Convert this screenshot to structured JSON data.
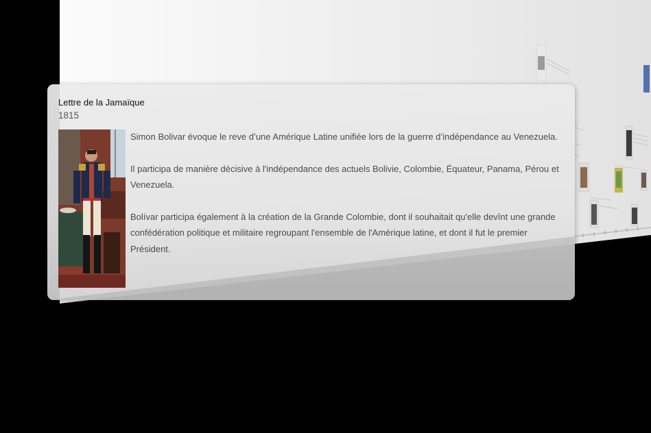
{
  "event": {
    "title": "Lettre de la Jamaïque",
    "year": "1815",
    "paragraphs": [
      "Simon Bolivar évoque le reve d’une Amérique Latine unifiée lors de la guerre d’indépendance au Venezuela.",
      "Il participa de manière décisive à l'indépendance des actuels Bolivie, Colombie, Équateur, Panama, Pérou et Venezuela.",
      "Bolívar participa également à la création de la Grande Colombie, dont il souhaitait qu'elle devînt une grande confédération politique et militaire regroupant l'ensemble de l'Amérique latine, et dont il fut le premier Président."
    ],
    "image": "simon-bolivar-portrait"
  },
  "colors": {
    "background": "#000000",
    "plane": "#f2f2f2",
    "card": "#e6e6e6",
    "title": "#111111",
    "body_text": "#4a4a4a"
  }
}
